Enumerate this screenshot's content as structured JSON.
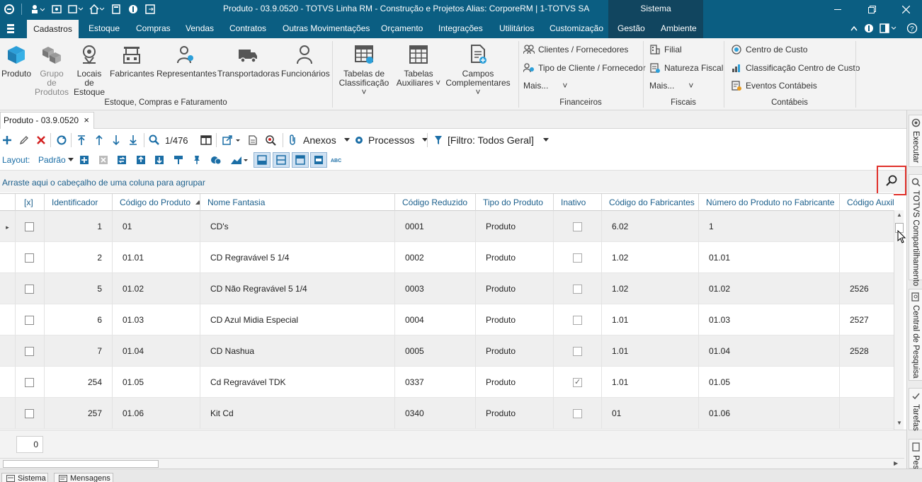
{
  "window": {
    "title": "Produto - 03.9.0520 - TOTVS Linha RM - Construção e Projetos  Alias: CorporeRM | 1-TOTVS SA",
    "system_tab": "Sistema"
  },
  "menu": {
    "items": [
      "Cadastros",
      "Estoque",
      "Compras",
      "Vendas",
      "Contratos",
      "Outras Movimentações",
      "Orçamento",
      "Integrações",
      "Utilitários",
      "Customização",
      "Gestão",
      "Ambiente"
    ],
    "active": "Cadastros"
  },
  "ribbon": {
    "buttons": {
      "produto": "Produto",
      "grupo_produtos": "Grupo de Produtos",
      "locais_estoque": "Locais de Estoque",
      "fabricantes": "Fabricantes",
      "representantes": "Representantes",
      "transportadoras": "Transportadoras",
      "funcionarios": "Funcionários",
      "tabelas_classificacao": "Tabelas de Classificação",
      "tabelas_auxiliares": "Tabelas Auxiliares",
      "campos_complementares": "Campos Complementares"
    },
    "financeiros": {
      "clientes": "Clientes / Fornecedores",
      "tipo_cliente": "Tipo de Cliente / Fornecedor",
      "mais": "Mais..."
    },
    "fiscais": {
      "filial": "Filial",
      "natureza": "Natureza Fiscal",
      "mais": "Mais..."
    },
    "contabeis": {
      "centro_custo": "Centro de Custo",
      "classificacao": "Classificação Centro de Custo",
      "eventos": "Eventos Contábeis"
    },
    "groups": {
      "estoque": "Estoque, Compras e Faturamento",
      "financeiros": "Financeiros",
      "fiscais": "Fiscais",
      "contabeis": "Contábeis"
    }
  },
  "doc_tab": {
    "label": "Produto - 03.9.0520",
    "close": "×"
  },
  "toolbar": {
    "record_position": "1/476",
    "anexos": "Anexos",
    "processos": "Processos",
    "filtro": "[Filtro: Todos Geral]",
    "layout_label": "Layout:",
    "layout_value": "Padrão"
  },
  "grid": {
    "group_hint": "Arraste aqui o cabeçalho de uma coluna para agrupar",
    "columns": [
      "[x]",
      "Identificador",
      "Código do Produto",
      "Nome Fantasia",
      "Código Reduzido",
      "Tipo do Produto",
      "Inativo",
      "Código do Fabricantes",
      "Número do Produto no Fabricante",
      "Código Auxiliar"
    ],
    "rows": [
      {
        "id": "1",
        "codigo": "01",
        "nome": "CD's",
        "reduzido": "0001",
        "tipo": "Produto",
        "inativo": false,
        "fab": "6.02",
        "num_fab": "1",
        "aux": ""
      },
      {
        "id": "2",
        "codigo": "01.01",
        "nome": "CD Regravável 5 1/4",
        "reduzido": "0002",
        "tipo": "Produto",
        "inativo": false,
        "fab": "1.02",
        "num_fab": "01.01",
        "aux": ""
      },
      {
        "id": "5",
        "codigo": "01.02",
        "nome": "CD Não Regravável 5 1/4",
        "reduzido": "0003",
        "tipo": "Produto",
        "inativo": false,
        "fab": "1.02",
        "num_fab": "01.02",
        "aux": "2526"
      },
      {
        "id": "6",
        "codigo": "01.03",
        "nome": "CD Azul Midia Especial",
        "reduzido": "0004",
        "tipo": "Produto",
        "inativo": false,
        "fab": "1.01",
        "num_fab": "01.03",
        "aux": "2527"
      },
      {
        "id": "7",
        "codigo": "01.04",
        "nome": "CD Nashua",
        "reduzido": "0005",
        "tipo": "Produto",
        "inativo": false,
        "fab": "1.01",
        "num_fab": "01.04",
        "aux": "2528"
      },
      {
        "id": "254",
        "codigo": "01.05",
        "nome": "Cd Regravável TDK",
        "reduzido": "0337",
        "tipo": "Produto",
        "inativo": true,
        "fab": "1.01",
        "num_fab": "01.05",
        "aux": ""
      },
      {
        "id": "257",
        "codigo": "01.06",
        "nome": "Kit Cd",
        "reduzido": "0340",
        "tipo": "Produto",
        "inativo": false,
        "fab": "01",
        "num_fab": "01.06",
        "aux": ""
      }
    ],
    "selected_count": "0"
  },
  "side_panel": [
    "Executar",
    "TOTVS Compartilhamento",
    "Central de Pesquisa",
    "Tarefas",
    "Pesq"
  ],
  "status_tabs": [
    "Sistema",
    "Mensagens"
  ],
  "colors": {
    "titlebar": "#0b5e82",
    "accent_blue": "#1b6ea6",
    "highlight_red": "#e0302a"
  }
}
